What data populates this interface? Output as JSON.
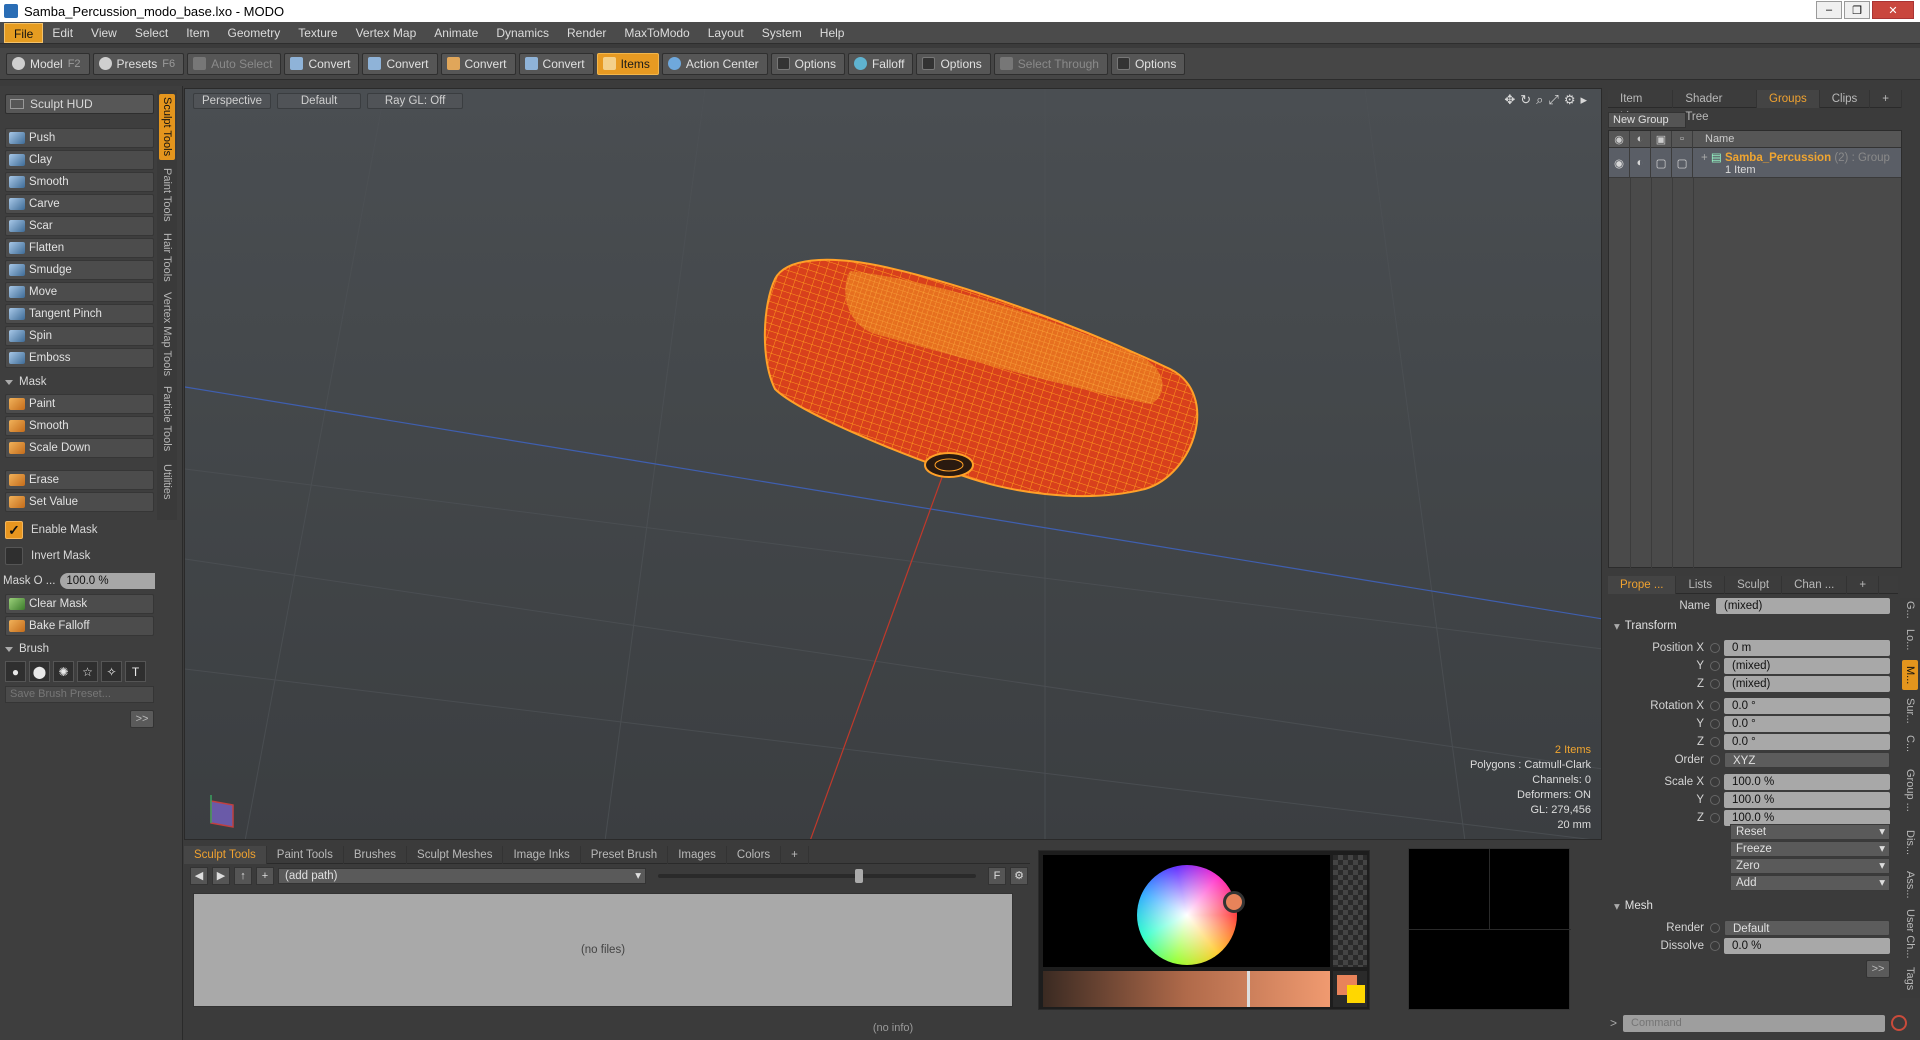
{
  "window": {
    "title": "Samba_Percussion_modo_base.lxo - MODO"
  },
  "menu": [
    "File",
    "Edit",
    "View",
    "Select",
    "Item",
    "Geometry",
    "Texture",
    "Vertex Map",
    "Animate",
    "Dynamics",
    "Render",
    "MaxToModo",
    "Layout",
    "System",
    "Help"
  ],
  "toolbar": {
    "model": "Model",
    "model_key": "F2",
    "presets": "Presets",
    "presets_key": "F6",
    "auto_select": "Auto Select",
    "convert1": "Convert",
    "convert2": "Convert",
    "convert3": "Convert",
    "convert4": "Convert",
    "items": "Items",
    "action_center": "Action Center",
    "options1": "Options",
    "falloff": "Falloff",
    "options2": "Options",
    "select_through": "Select Through",
    "options3": "Options"
  },
  "left": {
    "hud": "Sculpt HUD",
    "tools": [
      "Push",
      "Clay",
      "Smooth",
      "Carve",
      "Scar",
      "Flatten",
      "Smudge",
      "Move",
      "Tangent Pinch",
      "Spin",
      "Emboss"
    ],
    "mask_section": "Mask",
    "mask_tools": [
      "Paint",
      "Smooth",
      "Scale Down"
    ],
    "erase": "Erase",
    "set_value": "Set Value",
    "enable_mask": "Enable Mask",
    "invert_mask": "Invert Mask",
    "mask_opacity_label": "Mask O ...",
    "mask_opacity_value": "100.0 %",
    "clear_mask": "Clear Mask",
    "bake_falloff": "Bake Falloff",
    "brush_section": "Brush",
    "save_brush": "Save Brush Preset...",
    "more": ">>",
    "vtabs": [
      "Sculpt Tools",
      "Paint Tools",
      "Hair Tools",
      "Vertex Map Tools",
      "Particle Tools",
      "Utilities"
    ]
  },
  "viewport": {
    "view": "Perspective",
    "shading": "Default",
    "raygl": "Ray GL: Off",
    "info": {
      "items": "2 Items",
      "polygons": "Polygons : Catmull-Clark",
      "channels": "Channels: 0",
      "deformers": "Deformers: ON",
      "gl": "GL: 279,456",
      "scale": "20 mm"
    }
  },
  "groups_panel": {
    "tabs": [
      "Item List",
      "Shader Tree",
      "Groups",
      "Clips"
    ],
    "new_group": "New Group",
    "col_name": "Name",
    "group_name": "Samba_Percussion",
    "group_count": "(2) : Group",
    "group_items": "1 Item"
  },
  "properties": {
    "tabs": [
      "Prope ...",
      "Lists",
      "Sculpt",
      "Chan ..."
    ],
    "name_label": "Name",
    "name_value": "(mixed)",
    "transform": "Transform",
    "position_x_label": "Position X",
    "position_x": "0 m",
    "position_y": "(mixed)",
    "position_z": "(mixed)",
    "rotation_x_label": "Rotation X",
    "rotation_x": "0.0 °",
    "rotation_y": "0.0 °",
    "rotation_z": "0.0 °",
    "order_label": "Order",
    "order_value": "XYZ",
    "scale_x_label": "Scale X",
    "scale_x": "100.0 %",
    "scale_y": "100.0 %",
    "scale_z": "100.0 %",
    "y_label": "Y",
    "z_label": "Z",
    "reset": "Reset",
    "freeze": "Freeze",
    "zero": "Zero",
    "add": "Add",
    "mesh": "Mesh",
    "render_label": "Render",
    "render_value": "Default",
    "dissolve_label": "Dissolve",
    "dissolve_value": "0.0 %",
    "more": ">>",
    "vtabs": [
      "G...",
      "Lo...",
      "M...",
      "Sur...",
      "C...",
      "Group ...",
      "Dis...",
      "Ass...",
      "User Ch...",
      "Tags"
    ]
  },
  "command": {
    "placeholder": "Command"
  },
  "bottom": {
    "tabs": [
      "Sculpt Tools",
      "Paint Tools",
      "Brushes",
      "Sculpt Meshes",
      "Image Inks",
      "Preset Brush",
      "Images",
      "Colors"
    ],
    "path": "(add path)",
    "no_files": "(no files)",
    "status": "(no info)"
  },
  "colors": {
    "accent": "#e59c21",
    "mesh_fill": "#d8401c",
    "mesh_wire": "#ff9a1e"
  }
}
